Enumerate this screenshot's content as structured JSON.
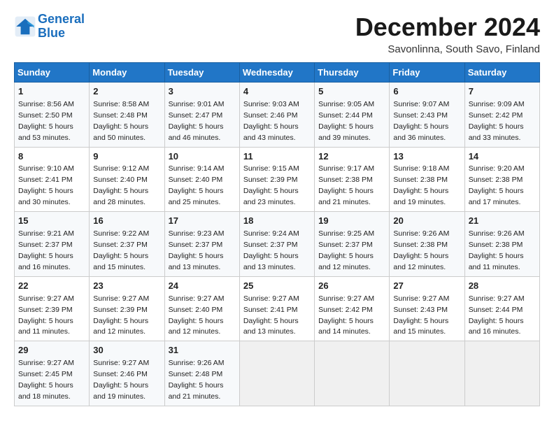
{
  "header": {
    "logo_line1": "General",
    "logo_line2": "Blue",
    "title": "December 2024",
    "subtitle": "Savonlinna, South Savo, Finland"
  },
  "weekdays": [
    "Sunday",
    "Monday",
    "Tuesday",
    "Wednesday",
    "Thursday",
    "Friday",
    "Saturday"
  ],
  "weeks": [
    [
      {
        "day": 1,
        "info": "Sunrise: 8:56 AM\nSunset: 2:50 PM\nDaylight: 5 hours\nand 53 minutes."
      },
      {
        "day": 2,
        "info": "Sunrise: 8:58 AM\nSunset: 2:48 PM\nDaylight: 5 hours\nand 50 minutes."
      },
      {
        "day": 3,
        "info": "Sunrise: 9:01 AM\nSunset: 2:47 PM\nDaylight: 5 hours\nand 46 minutes."
      },
      {
        "day": 4,
        "info": "Sunrise: 9:03 AM\nSunset: 2:46 PM\nDaylight: 5 hours\nand 43 minutes."
      },
      {
        "day": 5,
        "info": "Sunrise: 9:05 AM\nSunset: 2:44 PM\nDaylight: 5 hours\nand 39 minutes."
      },
      {
        "day": 6,
        "info": "Sunrise: 9:07 AM\nSunset: 2:43 PM\nDaylight: 5 hours\nand 36 minutes."
      },
      {
        "day": 7,
        "info": "Sunrise: 9:09 AM\nSunset: 2:42 PM\nDaylight: 5 hours\nand 33 minutes."
      }
    ],
    [
      {
        "day": 8,
        "info": "Sunrise: 9:10 AM\nSunset: 2:41 PM\nDaylight: 5 hours\nand 30 minutes."
      },
      {
        "day": 9,
        "info": "Sunrise: 9:12 AM\nSunset: 2:40 PM\nDaylight: 5 hours\nand 28 minutes."
      },
      {
        "day": 10,
        "info": "Sunrise: 9:14 AM\nSunset: 2:40 PM\nDaylight: 5 hours\nand 25 minutes."
      },
      {
        "day": 11,
        "info": "Sunrise: 9:15 AM\nSunset: 2:39 PM\nDaylight: 5 hours\nand 23 minutes."
      },
      {
        "day": 12,
        "info": "Sunrise: 9:17 AM\nSunset: 2:38 PM\nDaylight: 5 hours\nand 21 minutes."
      },
      {
        "day": 13,
        "info": "Sunrise: 9:18 AM\nSunset: 2:38 PM\nDaylight: 5 hours\nand 19 minutes."
      },
      {
        "day": 14,
        "info": "Sunrise: 9:20 AM\nSunset: 2:38 PM\nDaylight: 5 hours\nand 17 minutes."
      }
    ],
    [
      {
        "day": 15,
        "info": "Sunrise: 9:21 AM\nSunset: 2:37 PM\nDaylight: 5 hours\nand 16 minutes."
      },
      {
        "day": 16,
        "info": "Sunrise: 9:22 AM\nSunset: 2:37 PM\nDaylight: 5 hours\nand 15 minutes."
      },
      {
        "day": 17,
        "info": "Sunrise: 9:23 AM\nSunset: 2:37 PM\nDaylight: 5 hours\nand 13 minutes."
      },
      {
        "day": 18,
        "info": "Sunrise: 9:24 AM\nSunset: 2:37 PM\nDaylight: 5 hours\nand 13 minutes."
      },
      {
        "day": 19,
        "info": "Sunrise: 9:25 AM\nSunset: 2:37 PM\nDaylight: 5 hours\nand 12 minutes."
      },
      {
        "day": 20,
        "info": "Sunrise: 9:26 AM\nSunset: 2:38 PM\nDaylight: 5 hours\nand 12 minutes."
      },
      {
        "day": 21,
        "info": "Sunrise: 9:26 AM\nSunset: 2:38 PM\nDaylight: 5 hours\nand 11 minutes."
      }
    ],
    [
      {
        "day": 22,
        "info": "Sunrise: 9:27 AM\nSunset: 2:39 PM\nDaylight: 5 hours\nand 11 minutes."
      },
      {
        "day": 23,
        "info": "Sunrise: 9:27 AM\nSunset: 2:39 PM\nDaylight: 5 hours\nand 12 minutes."
      },
      {
        "day": 24,
        "info": "Sunrise: 9:27 AM\nSunset: 2:40 PM\nDaylight: 5 hours\nand 12 minutes."
      },
      {
        "day": 25,
        "info": "Sunrise: 9:27 AM\nSunset: 2:41 PM\nDaylight: 5 hours\nand 13 minutes."
      },
      {
        "day": 26,
        "info": "Sunrise: 9:27 AM\nSunset: 2:42 PM\nDaylight: 5 hours\nand 14 minutes."
      },
      {
        "day": 27,
        "info": "Sunrise: 9:27 AM\nSunset: 2:43 PM\nDaylight: 5 hours\nand 15 minutes."
      },
      {
        "day": 28,
        "info": "Sunrise: 9:27 AM\nSunset: 2:44 PM\nDaylight: 5 hours\nand 16 minutes."
      }
    ],
    [
      {
        "day": 29,
        "info": "Sunrise: 9:27 AM\nSunset: 2:45 PM\nDaylight: 5 hours\nand 18 minutes."
      },
      {
        "day": 30,
        "info": "Sunrise: 9:27 AM\nSunset: 2:46 PM\nDaylight: 5 hours\nand 19 minutes."
      },
      {
        "day": 31,
        "info": "Sunrise: 9:26 AM\nSunset: 2:48 PM\nDaylight: 5 hours\nand 21 minutes."
      },
      {
        "day": null,
        "info": ""
      },
      {
        "day": null,
        "info": ""
      },
      {
        "day": null,
        "info": ""
      },
      {
        "day": null,
        "info": ""
      }
    ]
  ]
}
